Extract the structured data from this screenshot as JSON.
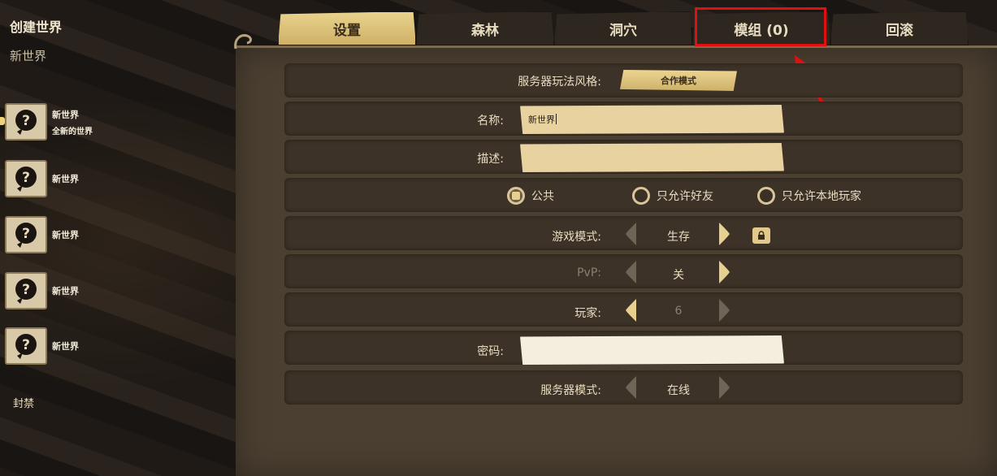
{
  "sidebar": {
    "title": "创建世界",
    "subtitle": "新世界",
    "slots": [
      {
        "name": "新世界",
        "desc": "全新的世界"
      },
      {
        "name": "新世界"
      },
      {
        "name": "新世界"
      },
      {
        "name": "新世界"
      },
      {
        "name": "新世界"
      }
    ],
    "ban_label": "封禁"
  },
  "tabs": [
    {
      "label": "设置",
      "active": true
    },
    {
      "label": "森林"
    },
    {
      "label": "洞穴"
    },
    {
      "label": "模组 (0)"
    },
    {
      "label": "回滚"
    }
  ],
  "settings": {
    "server_style_label": "服务器玩法风格:",
    "server_style_value": "合作模式",
    "name_label": "名称:",
    "name_value": "新世界",
    "desc_label": "描述:",
    "desc_value": "",
    "visibility": [
      "公共",
      "只允许好友",
      "只允许本地玩家"
    ],
    "visibility_selected": 0,
    "game_mode_label": "游戏模式:",
    "game_mode_value": "生存",
    "pvp_label": "PvP:",
    "pvp_value": "关",
    "players_label": "玩家:",
    "players_value": "6",
    "password_label": "密码:",
    "password_value": "",
    "server_mode_label": "服务器模式:",
    "server_mode_value": "在线"
  },
  "colors": {
    "highlight": "#e01010",
    "accent_gold": "#e9d38c"
  }
}
